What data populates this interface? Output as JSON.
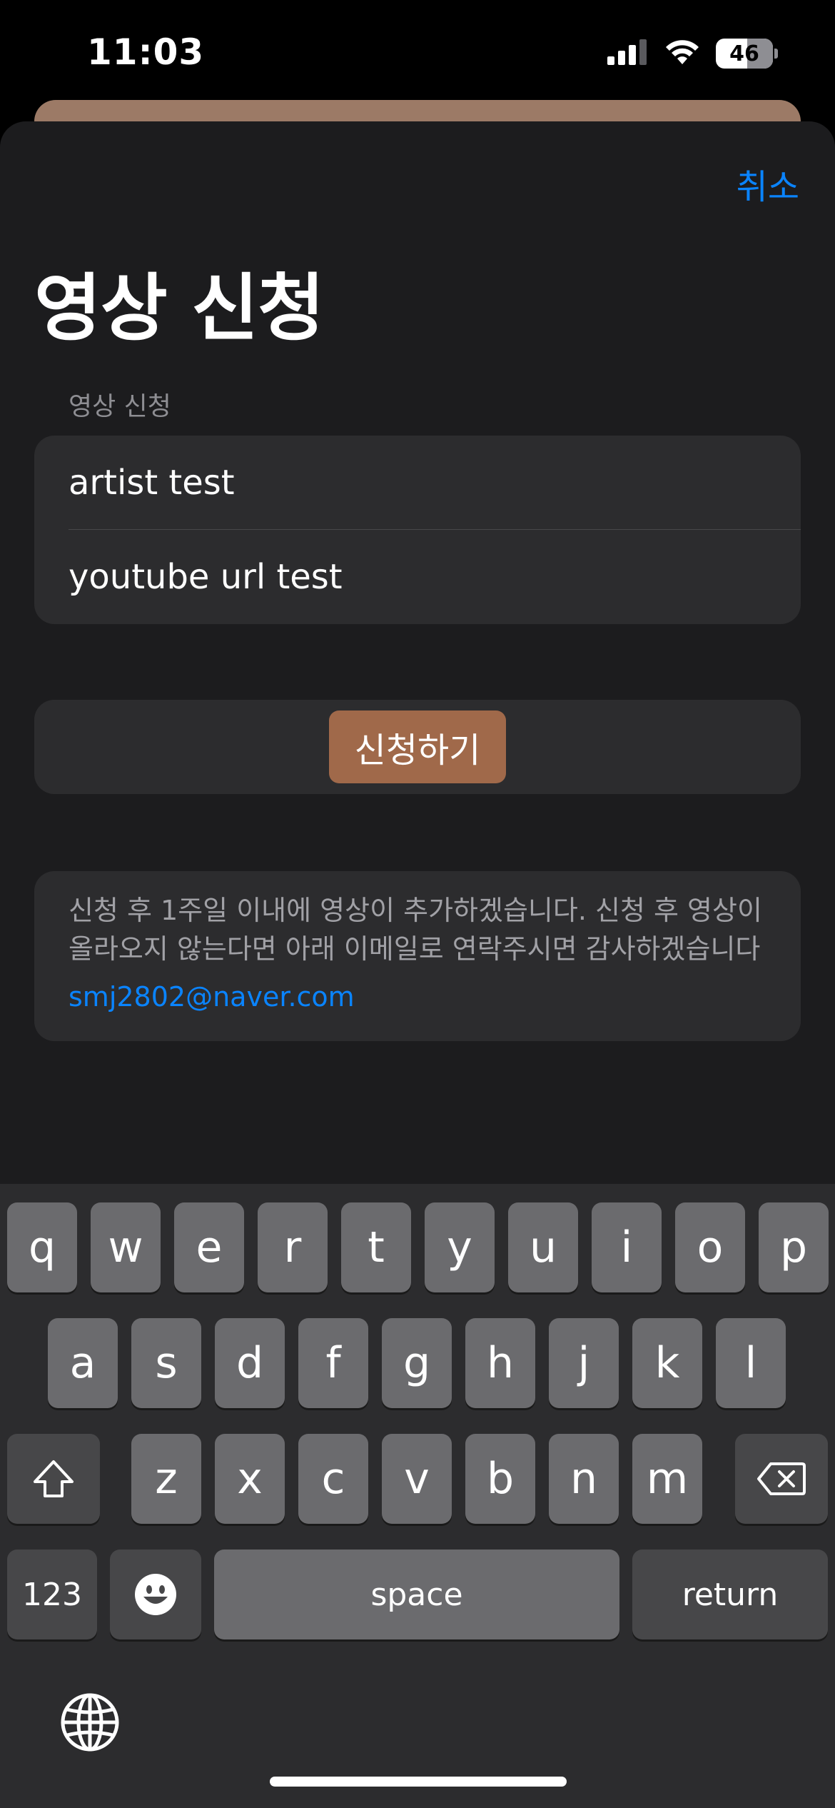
{
  "status": {
    "time": "11:03",
    "battery": "46"
  },
  "header": {
    "cancel_label": "취소",
    "title": "영상 신청"
  },
  "form": {
    "section_label": "영상 신청",
    "artist_value": "artist test",
    "url_value": "youtube url test"
  },
  "submit": {
    "label": "신청하기"
  },
  "info": {
    "line1": "신청 후 1주일 이내에 영상이 추가하겠습니다. 신청 후 영상이",
    "line2": "올라오지 않는다면 아래 이메일로 연락주시면 감사하겠습니다",
    "email": "smj2802@naver.com"
  },
  "keyboard": {
    "row1": [
      "q",
      "w",
      "e",
      "r",
      "t",
      "y",
      "u",
      "i",
      "o",
      "p"
    ],
    "row2": [
      "a",
      "s",
      "d",
      "f",
      "g",
      "h",
      "j",
      "k",
      "l"
    ],
    "row3": [
      "z",
      "x",
      "c",
      "v",
      "b",
      "n",
      "m"
    ],
    "numbers_label": "123",
    "space_label": "space",
    "return_label": "return"
  },
  "colors": {
    "accent": "#0a84ff",
    "submit": "#a0694a",
    "sheet": "#1c1c1e",
    "group": "#2c2c2e"
  }
}
